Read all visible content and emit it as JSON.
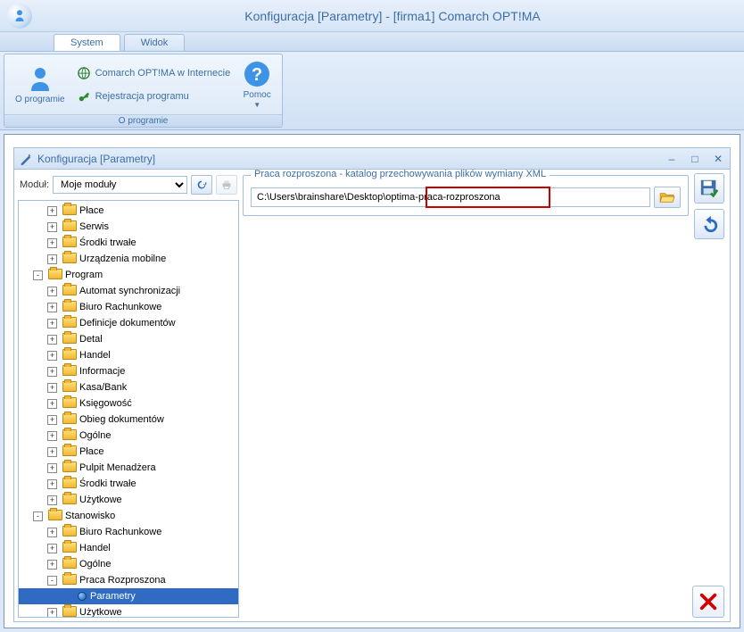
{
  "title": "Konfiguracja [Parametry] - [firma1] Comarch OPT!MA",
  "tabs": {
    "system": "System",
    "widok": "Widok"
  },
  "ribbon": {
    "group_title": "O programie",
    "about_btn": "O programie",
    "link_internet": "Comarch OPT!MA w Internecie",
    "link_register": "Rejestracja programu",
    "help_btn": "Pomoc"
  },
  "inner_window": {
    "title": "Konfiguracja [Parametry]",
    "module_label": "Moduł:",
    "module_value": "Moje moduły"
  },
  "tree": {
    "place": "Płace",
    "serwis": "Serwis",
    "srodki_trwale": "Środki trwałe",
    "urzadzenia_mobilne": "Urządzenia mobilne",
    "program": "Program",
    "automat_sync": "Automat synchronizacji",
    "biuro_rachunkowe": "Biuro Rachunkowe",
    "definicje_dok": "Definicje dokumentów",
    "detal": "Detal",
    "handel": "Handel",
    "informacje": "Informacje",
    "kasa_bank": "Kasa/Bank",
    "ksiegowosc": "Księgowość",
    "obieg_dok": "Obieg dokumentów",
    "ogolne": "Ogólne",
    "place2": "Płace",
    "pulpit": "Pulpit Menadżera",
    "srodki2": "Środki trwałe",
    "uzytkowe": "Użytkowe",
    "stanowisko": "Stanowisko",
    "biuro2": "Biuro Rachunkowe",
    "handel2": "Handel",
    "ogolne2": "Ogólne",
    "praca_rozp": "Praca Rozproszona",
    "parametry": "Parametry",
    "uzytkowe2": "Użytkowe"
  },
  "form": {
    "legend": "Praca rozproszona - katalog przechowywania plików wymiany XML",
    "path_value": "C:\\Users\\brainshare\\Desktop\\optima-praca-rozproszona"
  }
}
